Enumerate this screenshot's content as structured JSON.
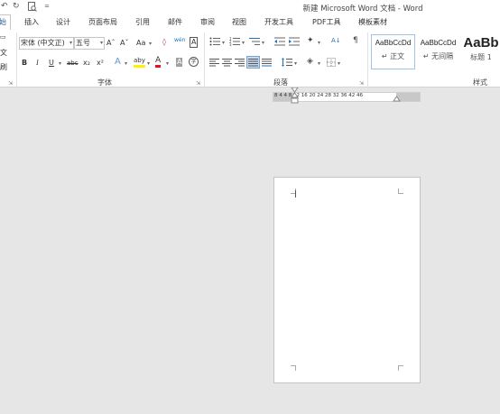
{
  "window": {
    "title": "新建 Microsoft Word 文档 - Word"
  },
  "quick_access": {
    "undo_icon": "undo-icon",
    "redo_icon": "redo-icon",
    "preview_icon": "print-preview-icon",
    "customize_glyph": "="
  },
  "tabs": [
    {
      "label": "始"
    },
    {
      "label": "插入"
    },
    {
      "label": "设计"
    },
    {
      "label": "页面布局"
    },
    {
      "label": "引用"
    },
    {
      "label": "邮件"
    },
    {
      "label": "审阅"
    },
    {
      "label": "视图"
    },
    {
      "label": "开发工具"
    },
    {
      "label": "PDF工具"
    },
    {
      "label": "模板素材"
    }
  ],
  "clipboard": {
    "label_fragment_1": "文",
    "label_fragment_2": "刷"
  },
  "font": {
    "name_value": "宋体 (中文正)",
    "size_value": "五号",
    "grow_label": "Aˆ",
    "shrink_label": "Aˇ",
    "case_label": "Aa",
    "clear_icon": "clear-formatting-icon",
    "phonetic_label": "wén",
    "border_label": "A",
    "bold_label": "B",
    "italic_label": "I",
    "underline_label": "U",
    "strike_label": "abc",
    "subscript_label": "x₂",
    "superscript_label": "x²",
    "effects_label": "A",
    "highlight_label": "aby",
    "color_label": "A",
    "shade_label": "A",
    "enclose_label": "字",
    "group_label": "字体",
    "font_color": "#e81123",
    "highlight_color": "#fff200"
  },
  "paragraph": {
    "bullets_icon": "bullets-icon",
    "numbering_icon": "numbering-icon",
    "multilevel_icon": "multilevel-list-icon",
    "decrease_indent_icon": "decrease-indent-icon",
    "increase_indent_icon": "increase-indent-icon",
    "chinese_layout_icon": "chinese-layout-icon",
    "sort_icon": "sort-icon",
    "show_marks_icon": "show-marks-icon",
    "align_left_icon": "align-left-icon",
    "center_icon": "center-icon",
    "align_right_icon": "align-right-icon",
    "justify_icon": "justify-icon",
    "distributed_icon": "distributed-icon",
    "line_spacing_icon": "line-spacing-icon",
    "shading_icon": "shading-icon",
    "borders_icon": "borders-icon",
    "group_label": "段落"
  },
  "styles": {
    "items": [
      {
        "sample": "AaBbCcDd",
        "name": "↵ 正文"
      },
      {
        "sample": "AaBbCcDd",
        "name": "↵ 无间隔"
      },
      {
        "sample": "AaBb",
        "name": "标题 1"
      }
    ],
    "group_label": "样式"
  },
  "ruler": {
    "numbers": "8  4      4   8  12  16  20  24  28  32  36     42  46"
  },
  "colors": {
    "accent": "#2b579a",
    "canvas": "#e6e6e6"
  }
}
